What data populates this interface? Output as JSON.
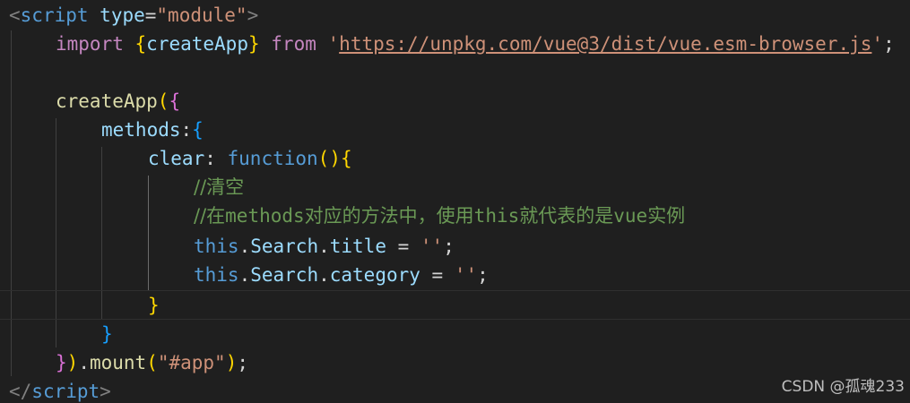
{
  "code": {
    "script_open": {
      "lt": "<",
      "tag": "script",
      "attr": "type",
      "eq": "=",
      "value": "\"module\"",
      "gt": ">"
    },
    "import_line": {
      "kw_import": "import",
      "brace_open": "{",
      "name": "createApp",
      "brace_close": "}",
      "kw_from": "from",
      "q1": "'",
      "url": "https://unpkg.com/vue@3/dist/vue.esm-browser.js",
      "q2": "'",
      "semi": ";"
    },
    "create_app_line": {
      "fn": "createApp",
      "paren": "(",
      "brace": "{"
    },
    "methods_line": {
      "key": "methods",
      "colon": ":",
      "brace": "{"
    },
    "clear_line": {
      "key": "clear",
      "colon": ": ",
      "kw": "function",
      "parens": "()",
      "brace": "{"
    },
    "comment1": "//清空",
    "comment2_prefix": "//在",
    "comment2_word1": "methods",
    "comment2_mid": "对应的方法中，使用",
    "comment2_word2": "this",
    "comment2_mid2": "就代表的是",
    "comment2_word3": "vue",
    "comment2_suffix": "实例",
    "assign1": {
      "this": "this",
      "dot1": ".",
      "obj": "Search",
      "dot2": ".",
      "prop": "title",
      "op": " = ",
      "val": "''",
      "semi": ";"
    },
    "assign2": {
      "this": "this",
      "dot1": ".",
      "obj": "Search",
      "dot2": ".",
      "prop": "category",
      "op": " = ",
      "val": "''",
      "semi": ";"
    },
    "close_clear": "}",
    "close_methods": "}",
    "mount_line": {
      "brace": "}",
      "paren": ")",
      "dot": ".",
      "fn": "mount",
      "p_open": "(",
      "arg": "\"#app\"",
      "p_close": ")",
      "semi": ";"
    },
    "script_close": {
      "lt": "</",
      "tag": "script",
      "gt": ">"
    }
  },
  "watermark": "CSDN @孤魂233"
}
